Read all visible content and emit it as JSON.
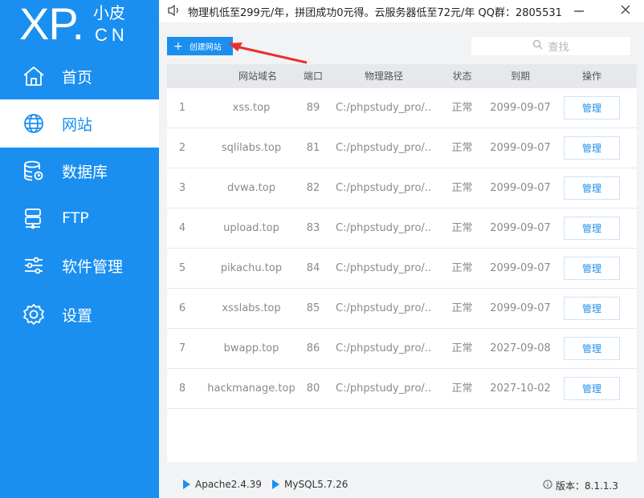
{
  "logo": {
    "brand": "XP.",
    "cn_top": "小皮",
    "cn_bottom": "CN"
  },
  "sidebar": {
    "items": [
      {
        "label": "首页",
        "icon": "home-icon"
      },
      {
        "label": "网站",
        "icon": "globe-icon",
        "active": true
      },
      {
        "label": "数据库",
        "icon": "database-icon"
      },
      {
        "label": "FTP",
        "icon": "server-icon"
      },
      {
        "label": "软件管理",
        "icon": "sliders-icon"
      },
      {
        "label": "设置",
        "icon": "gear-icon"
      }
    ]
  },
  "topbar": {
    "notice": "物理机低至299元/年，拼团成功0元得。云服务器低至72元/年  QQ群：2805531"
  },
  "toolbar": {
    "create_label": "创建网站",
    "search_placeholder": "查找"
  },
  "table": {
    "headers": [
      "网站域名",
      "端口",
      "物理路径",
      "状态",
      "到期",
      "操作"
    ],
    "rows": [
      {
        "index": "1",
        "domain": "xss.top",
        "port": "89",
        "path": "C:/phpstudy_pro/...",
        "status": "正常",
        "expire": "2099-09-07",
        "action": "管理"
      },
      {
        "index": "2",
        "domain": "sqlilabs.top",
        "port": "81",
        "path": "C:/phpstudy_pro/...",
        "status": "正常",
        "expire": "2099-09-07",
        "action": "管理"
      },
      {
        "index": "3",
        "domain": "dvwa.top",
        "port": "82",
        "path": "C:/phpstudy_pro/...",
        "status": "正常",
        "expire": "2099-09-07",
        "action": "管理"
      },
      {
        "index": "4",
        "domain": "upload.top",
        "port": "83",
        "path": "C:/phpstudy_pro/...",
        "status": "正常",
        "expire": "2099-09-07",
        "action": "管理"
      },
      {
        "index": "5",
        "domain": "pikachu.top",
        "port": "84",
        "path": "C:/phpstudy_pro/...",
        "status": "正常",
        "expire": "2099-09-07",
        "action": "管理"
      },
      {
        "index": "6",
        "domain": "xsslabs.top",
        "port": "85",
        "path": "C:/phpstudy_pro/...",
        "status": "正常",
        "expire": "2099-09-07",
        "action": "管理"
      },
      {
        "index": "7",
        "domain": "bwapp.top",
        "port": "86",
        "path": "C:/phpstudy_pro/...",
        "status": "正常",
        "expire": "2027-09-08",
        "action": "管理"
      },
      {
        "index": "8",
        "domain": "hackmanage.top",
        "port": "80",
        "path": "C:/phpstudy_pro/...",
        "status": "正常",
        "expire": "2027-10-02",
        "action": "管理"
      }
    ]
  },
  "footer": {
    "apache": "Apache2.4.39",
    "mysql": "MySQL5.7.26",
    "version": "版本：8.1.1.3"
  },
  "colors": {
    "accent": "#1a8ff0",
    "annotation": "#e8302d"
  }
}
